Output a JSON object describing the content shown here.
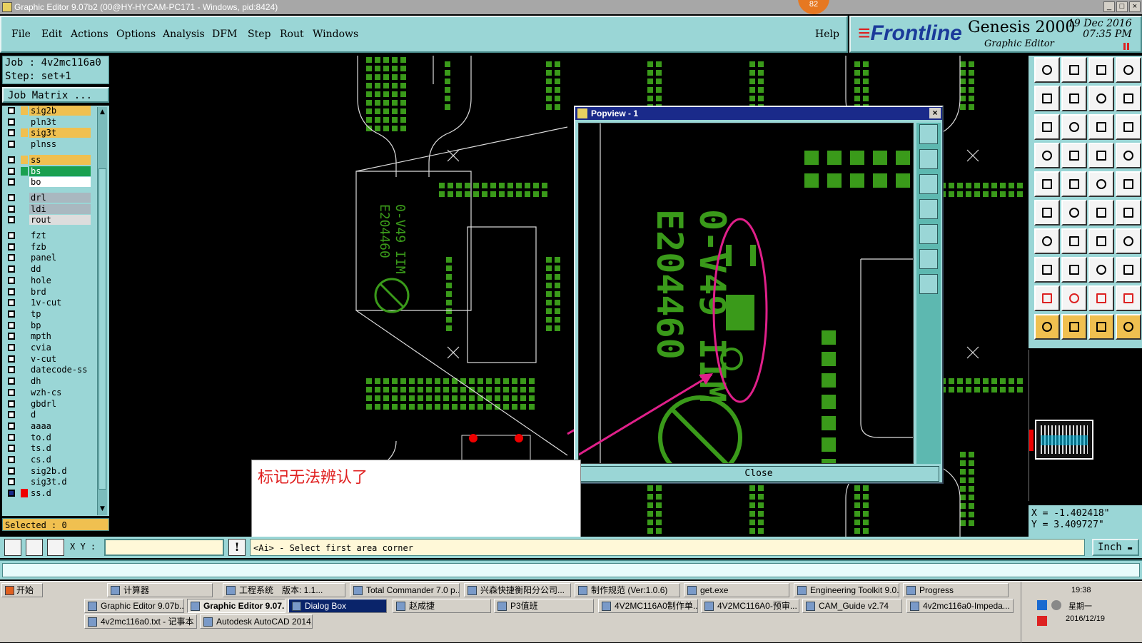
{
  "window": {
    "title": "Graphic Editor 9.07b2 (00@HY-HYCAM-PC171 - Windows, pid:8424)",
    "badge": "82",
    "controls": [
      "_",
      "□",
      "×"
    ]
  },
  "menu": {
    "items": [
      "File",
      "Edit",
      "Actions",
      "Options",
      "Analysis",
      "DFM",
      "Step",
      "Rout",
      "Windows"
    ],
    "help": "Help"
  },
  "brand": {
    "logo": "Frontline",
    "product": "Genesis 2000",
    "subtitle": "Graphic Editor",
    "date": "19 Dec 2016",
    "time": "07:35 PM"
  },
  "job": {
    "job_line": "Job : 4v2mc116a0",
    "step_line": "Step: set+1",
    "matrix_button": "Job Matrix ..."
  },
  "layers": [
    {
      "name": "sig2b",
      "color": "#f0c050"
    },
    {
      "name": "pln3t",
      "color": "#9ad6d6"
    },
    {
      "name": "sig3t",
      "color": "#f0c050"
    },
    {
      "name": "plnss",
      "color": "#9ad6d6"
    },
    {
      "name": "ss",
      "color": "#f0c050"
    },
    {
      "name": "bs",
      "color": "#1aa050"
    },
    {
      "name": "bo",
      "color": "#ffffff"
    },
    {
      "name": "drl",
      "color": "#a9b8c0"
    },
    {
      "name": "ldi",
      "color": "#a9b8c0"
    },
    {
      "name": "rout",
      "color": "#dddddd"
    },
    {
      "name": "fzt",
      "color": "#9ad6d6"
    },
    {
      "name": "fzb",
      "color": "#9ad6d6"
    },
    {
      "name": "panel",
      "color": "#9ad6d6"
    },
    {
      "name": "dd",
      "color": "#9ad6d6"
    },
    {
      "name": "hole",
      "color": "#9ad6d6"
    },
    {
      "name": "brd",
      "color": "#9ad6d6"
    },
    {
      "name": "1v-cut",
      "color": "#9ad6d6"
    },
    {
      "name": "tp",
      "color": "#9ad6d6"
    },
    {
      "name": "bp",
      "color": "#9ad6d6"
    },
    {
      "name": "mpth",
      "color": "#9ad6d6"
    },
    {
      "name": "cvia",
      "color": "#9ad6d6"
    },
    {
      "name": "v-cut",
      "color": "#9ad6d6"
    },
    {
      "name": "datecode-ss",
      "color": "#9ad6d6"
    },
    {
      "name": "dh",
      "color": "#9ad6d6"
    },
    {
      "name": "wzh-cs",
      "color": "#9ad6d6"
    },
    {
      "name": "gbdrl",
      "color": "#9ad6d6"
    },
    {
      "name": "d",
      "color": "#9ad6d6"
    },
    {
      "name": "aaaa",
      "color": "#9ad6d6"
    },
    {
      "name": "to.d",
      "color": "#9ad6d6"
    },
    {
      "name": "ts.d",
      "color": "#9ad6d6"
    },
    {
      "name": "cs.d",
      "color": "#9ad6d6"
    },
    {
      "name": "sig2b.d",
      "color": "#9ad6d6"
    },
    {
      "name": "sig3t.d",
      "color": "#9ad6d6"
    },
    {
      "name": "ss.d",
      "color": "#9ad6d6"
    }
  ],
  "selected": "Selected : 0",
  "popup": {
    "title": "Popview - 1",
    "close_label": "Close",
    "marking_text": "E204460",
    "marking_text2": "0-V49 IIM"
  },
  "annotation": {
    "text": "标记无法辨认了"
  },
  "coords": {
    "x": "X = -1.402418\"",
    "y": "Y = 3.409727\""
  },
  "command": {
    "xy_label": "X Y :",
    "prompt": "<Ai> - Select first area corner",
    "unit": "Inch"
  },
  "taskbar": {
    "start": "开始",
    "row1": [
      "计算器",
      "工程系统　版本: 1.1...",
      "Total Commander 7.0 p...",
      "兴森快捷衡阳分公司...",
      "制作规范 (Ver:1.0.6)",
      "get.exe",
      "Engineering Toolkit 9.0...",
      "Progress"
    ],
    "row2": [
      "Graphic Editor 9.07b...",
      "Graphic Editor 9.07...",
      "Dialog Box",
      "赵成捷",
      "P3值班",
      "4V2MC116A0制作单...",
      "4V2MC116A0-预审...",
      "CAM_Guide v2.74",
      "4v2mc116a0-Impeda..."
    ],
    "row3": [
      "4v2mc116a0.txt - 记事本",
      "Autodesk AutoCAD 2014..."
    ],
    "clock": "19:38",
    "weekday": "星期一",
    "date": "2016/12/19"
  },
  "colors": {
    "panel": "#9ad6d6",
    "pcb_green": "#3a9a1a",
    "annotation_red": "#e02020",
    "magenta": "#e0208a"
  }
}
